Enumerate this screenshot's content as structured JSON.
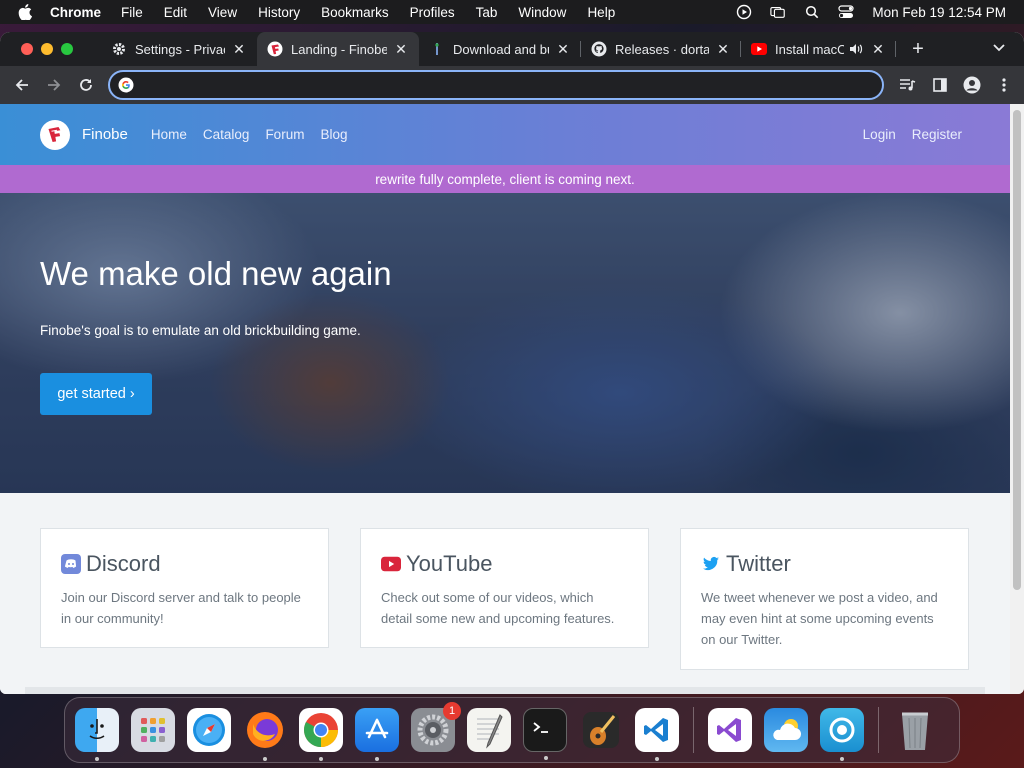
{
  "menubar": {
    "app_name": "Chrome",
    "items": [
      "File",
      "Edit",
      "View",
      "History",
      "Bookmarks",
      "Profiles",
      "Tab",
      "Window",
      "Help"
    ],
    "clock": "Mon Feb 19  12:54 PM"
  },
  "browser": {
    "tabs": [
      {
        "label": "Settings - Privacy",
        "icon": "gear-icon",
        "close": "✕"
      },
      {
        "label": "Landing - Finobe",
        "icon": "finobe-icon",
        "close": "✕"
      },
      {
        "label": "Download and bu",
        "icon": "wand-icon",
        "close": "✕"
      },
      {
        "label": "Releases · dortar",
        "icon": "github-icon",
        "close": "✕"
      },
      {
        "label": "Install macOS",
        "icon": "youtube-icon",
        "close": "✕"
      }
    ],
    "active_tab_index": 1,
    "new_tab": "+",
    "omnibox": {
      "value": "",
      "placeholder": ""
    }
  },
  "site": {
    "brand": "Finobe",
    "nav": [
      "Home",
      "Catalog",
      "Forum",
      "Blog"
    ],
    "auth": {
      "login": "Login",
      "register": "Register"
    },
    "banner": "rewrite fully complete, client is coming next.",
    "hero": {
      "title": "We make old new again",
      "subtitle": "Finobe's goal is to emulate an old brickbuilding game.",
      "cta": "get started ›"
    },
    "cards": [
      {
        "title": "Discord",
        "icon": "discord-icon",
        "text": "Join our Discord server and talk to people in our community!"
      },
      {
        "title": "YouTube",
        "icon": "youtube-icon",
        "text": "Check out some of our videos, which detail some new and upcoming features."
      },
      {
        "title": "Twitter",
        "icon": "twitter-icon",
        "text": "We tweet whenever we post a video, and may even hint at some upcoming events on our Twitter."
      }
    ]
  },
  "dock": {
    "apps": [
      "Finder",
      "Launchpad",
      "Safari",
      "Firefox",
      "Chrome",
      "App Store",
      "System Settings",
      "TextEdit",
      "Terminal",
      "GarageBand",
      "Visual Studio Code",
      "Visual Studio",
      "Weather",
      "Proxyman",
      "Trash"
    ],
    "settings_badge": "1"
  },
  "colors": {
    "nav_gradient_start": "#3a8fd6",
    "nav_gradient_end": "#8a7ad6",
    "banner": "#b06ad0",
    "cta": "#1a8fe0",
    "focus_ring": "#8ab4f8"
  }
}
